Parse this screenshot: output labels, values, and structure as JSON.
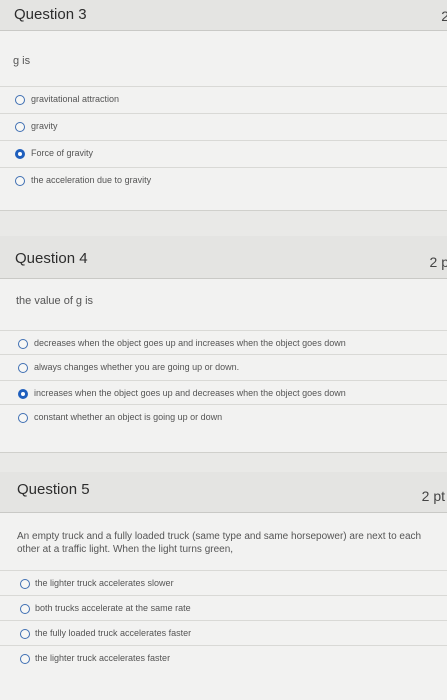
{
  "q3": {
    "title": "Question 3",
    "points": "2",
    "prompt": "g is",
    "answers": [
      {
        "label": "gravitational attraction",
        "selected": false
      },
      {
        "label": "gravity",
        "selected": false
      },
      {
        "label": "Force of gravity",
        "selected": true
      },
      {
        "label": "the acceleration due to gravity",
        "selected": false
      }
    ]
  },
  "q4": {
    "title": "Question 4",
    "points": "2 p",
    "prompt": "the value of g is",
    "answers": [
      {
        "label": "decreases when the object goes up and increases when the object goes down",
        "selected": false
      },
      {
        "label": "always changes whether you are going up or down.",
        "selected": false
      },
      {
        "label": "increases when the object goes up and decreases when the object goes down",
        "selected": true
      },
      {
        "label": "constant whether an object is going up or down",
        "selected": false
      }
    ]
  },
  "q5": {
    "title": "Question 5",
    "points": "2 pt",
    "prompt": "An empty truck and a fully loaded truck (same type and same horsepower) are next to each other at a traffic light.  When the light turns green,",
    "answers": [
      {
        "label": "the lighter truck accelerates slower",
        "selected": false
      },
      {
        "label": "both trucks accelerate at the same rate",
        "selected": false
      },
      {
        "label": "the fully loaded truck accelerates faster",
        "selected": false
      },
      {
        "label": "the lighter truck accelerates faster",
        "selected": false
      }
    ]
  },
  "colors": {
    "radio": "#3f6fb3",
    "radio_selected": "#1f5fbd",
    "header_bg": "#e4e4e2"
  }
}
